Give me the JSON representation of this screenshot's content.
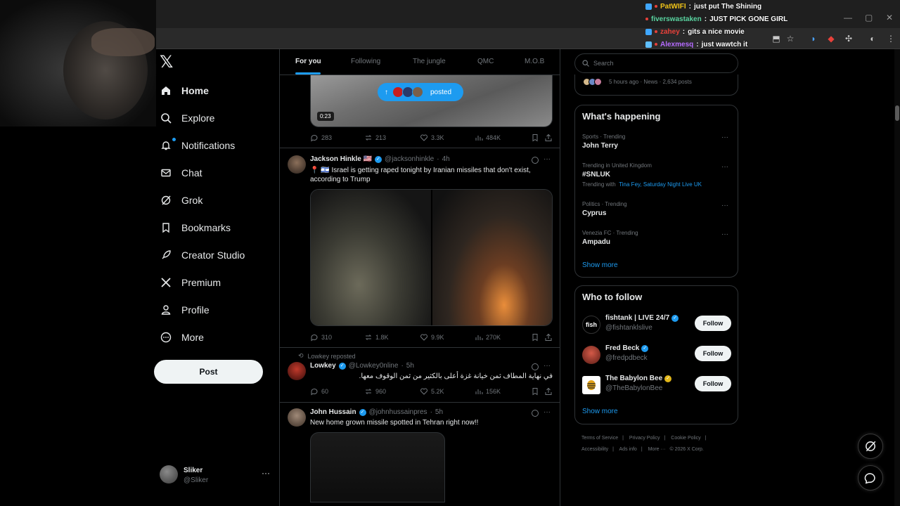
{
  "chat": [
    {
      "user": "PatWIFI",
      "color": "#f0c419",
      "text": "just put The Shining"
    },
    {
      "user": "fiverswastaken",
      "color": "#59d4a0",
      "text": "JUST PICK GONE GIRL"
    },
    {
      "user": "zahey",
      "color": "#e8413a",
      "text": "gits a nice movie"
    },
    {
      "user": "Alexmesq",
      "color": "#b56bff",
      "text": "just wawtch it"
    }
  ],
  "nav": {
    "items": [
      {
        "label": "Home",
        "icon": "home-icon"
      },
      {
        "label": "Explore",
        "icon": "search-icon"
      },
      {
        "label": "Notifications",
        "icon": "bell-icon"
      },
      {
        "label": "Chat",
        "icon": "mail-icon"
      },
      {
        "label": "Grok",
        "icon": "grok-icon"
      },
      {
        "label": "Bookmarks",
        "icon": "bookmark-icon"
      },
      {
        "label": "Creator Studio",
        "icon": "rocket-icon"
      },
      {
        "label": "Premium",
        "icon": "x-icon"
      },
      {
        "label": "Profile",
        "icon": "person-icon"
      },
      {
        "label": "More",
        "icon": "more-circle-icon"
      }
    ],
    "post_button": "Post",
    "account": {
      "name": "Sliker",
      "handle": "@Sliker"
    }
  },
  "tabs": [
    "For you",
    "Following",
    "The jungle",
    "QMC",
    "M.O.B"
  ],
  "first_post": {
    "video_time": "0:23",
    "posted_pill": "posted",
    "stats": {
      "replies": "283",
      "reposts": "213",
      "likes": "3.3K",
      "views": "484K"
    }
  },
  "posts": [
    {
      "name": "Jackson Hinkle 🇺🇸",
      "handle": "@jacksonhinkle",
      "time": "4h",
      "text": "📍 🇮🇱 Israel is getting raped tonight by Iranian missiles that don't exist, according to Trump",
      "stats": {
        "replies": "310",
        "reposts": "1.8K",
        "likes": "9.9K",
        "views": "270K"
      }
    },
    {
      "repost_by": "Lowkey reposted",
      "name": "Lowkey",
      "handle": "@Lowkey0nline",
      "time": "5h",
      "text": "في نهاية المطاف ثمن خيانة غزة أعلى بالكثير من ثمن الوقوف معها.",
      "stats": {
        "replies": "60",
        "reposts": "960",
        "likes": "5.2K",
        "views": "156K"
      }
    },
    {
      "name": "John Hussain",
      "handle": "@johnhussainpres",
      "time": "5h",
      "text": "New home grown missile spotted in Tehran right now!!"
    }
  ],
  "right": {
    "search_placeholder": "Search",
    "news_meta": "5 hours ago · News · 2,634 posts",
    "happening_title": "What's happening",
    "trends": [
      {
        "category": "Sports · Trending",
        "name": "John Terry"
      },
      {
        "category": "Trending in United Kingdom",
        "name": "#SNLUK",
        "with_label": "Trending with",
        "with": "Tina Fey, Saturday Night Live UK"
      },
      {
        "category": "Politics · Trending",
        "name": "Cyprus"
      },
      {
        "category": "Venezia FC · Trending",
        "name": "Ampadu"
      }
    ],
    "show_more": "Show more",
    "follow_title": "Who to follow",
    "follow": [
      {
        "name": "fishtank | LIVE 24/7",
        "handle": "@fishtanklslive",
        "button": "Follow",
        "avatar_text": "fish"
      },
      {
        "name": "Fred Beck",
        "handle": "@fredpdbeck",
        "button": "Follow"
      },
      {
        "name": "The Babylon Bee",
        "handle": "@TheBabylonBee",
        "button": "Follow"
      }
    ],
    "follow_show_more": "Show more",
    "footer": [
      "Terms of Service",
      "|",
      "Privacy Policy",
      "|",
      "Cookie Policy",
      "|",
      "Accessibility",
      "|",
      "Ads info",
      "|",
      "More ···",
      "© 2026 X Corp."
    ]
  }
}
